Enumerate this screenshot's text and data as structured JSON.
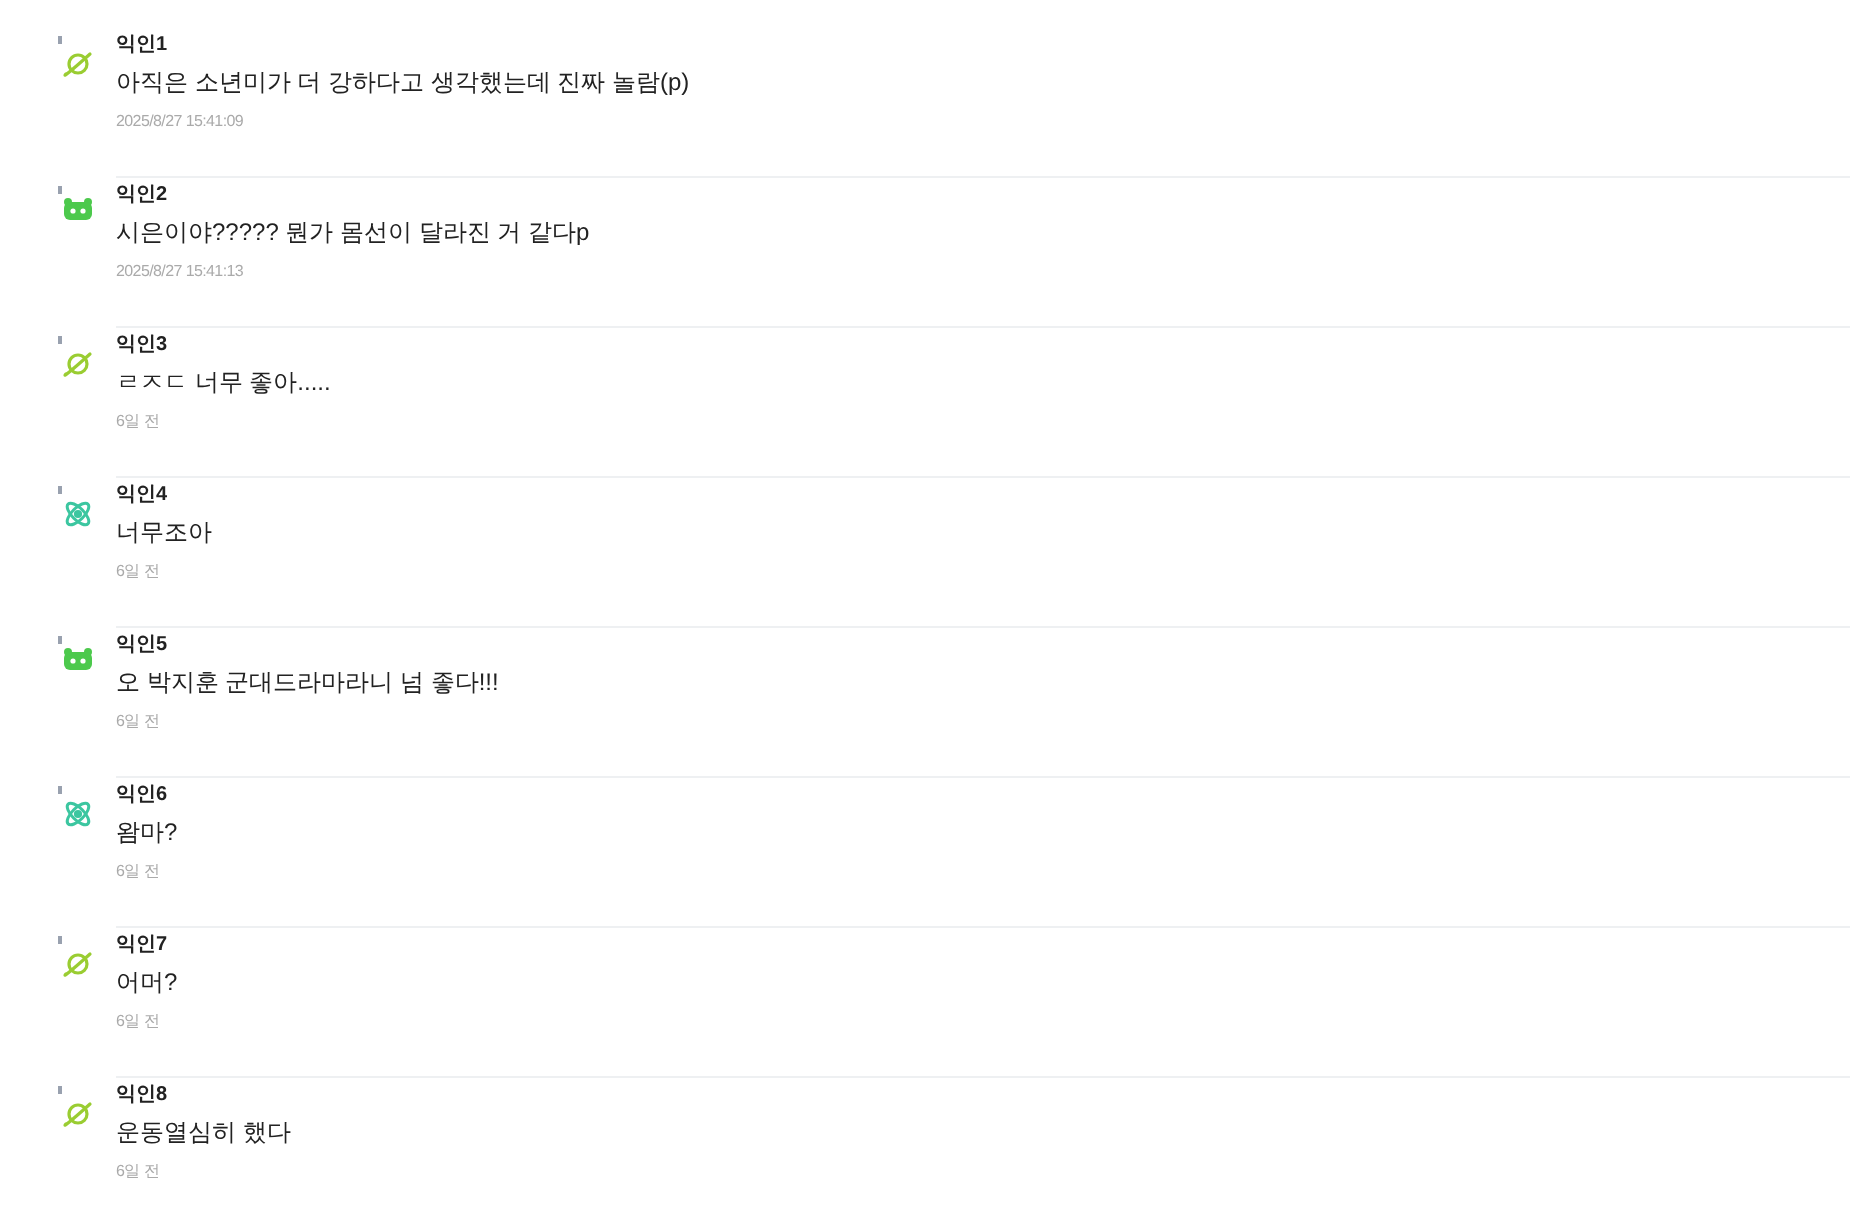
{
  "comments": [
    {
      "avatar": {
        "kind": "planet"
      },
      "author": "익인1",
      "text": "아직은 소년미가 더 강하다고 생각했는데 진짜 놀람(p)",
      "time": "2025/8/27 15:41:09"
    },
    {
      "avatar": {
        "kind": "robot"
      },
      "author": "익인2",
      "text": "시은이야????? 뭔가 몸선이 달라진 거 같다p",
      "time": "2025/8/27 15:41:13"
    },
    {
      "avatar": {
        "kind": "planet"
      },
      "author": "익인3",
      "text": "ㄹㅈㄷ 너무 좋아.....",
      "time": "6일 전"
    },
    {
      "avatar": {
        "kind": "atom"
      },
      "author": "익인4",
      "text": "너무조아",
      "time": "6일 전"
    },
    {
      "avatar": {
        "kind": "robot"
      },
      "author": "익인5",
      "text": "오 박지훈 군대드라마라니 넘 좋다!!!",
      "time": "6일 전"
    },
    {
      "avatar": {
        "kind": "atom"
      },
      "author": "익인6",
      "text": "왐마?",
      "time": "6일 전"
    },
    {
      "avatar": {
        "kind": "planet"
      },
      "author": "익인7",
      "text": "어머?",
      "time": "6일 전"
    },
    {
      "avatar": {
        "kind": "planet"
      },
      "author": "익인8",
      "text": "운동열심히 했다",
      "time": "6일 전"
    }
  ]
}
